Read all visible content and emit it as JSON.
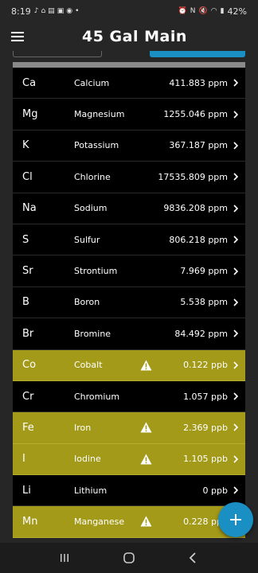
{
  "status_bar": {
    "time": "8:19",
    "battery": "42%",
    "icons_left": [
      "tiktok-icon",
      "home-icon",
      "news-icon",
      "gallery-icon",
      "app-icon",
      "dot-icon"
    ],
    "icons_right": [
      "alarm-icon",
      "nfc-icon",
      "mute-icon",
      "wifi-icon",
      "signal-icon"
    ]
  },
  "app_bar": {
    "title": "45 Gal Main",
    "menu_icon": "hamburger-menu-icon"
  },
  "colors": {
    "background": "#262626",
    "row": "#000000",
    "warning_row": "#a39a1a",
    "accent": "#1a8fc4"
  },
  "elements": [
    {
      "symbol": "Ca",
      "name": "Calcium",
      "value": "411.883 ppm",
      "warning": false
    },
    {
      "symbol": "Mg",
      "name": "Magnesium",
      "value": "1255.046 ppm",
      "warning": false
    },
    {
      "symbol": "K",
      "name": "Potassium",
      "value": "367.187 ppm",
      "warning": false
    },
    {
      "symbol": "Cl",
      "name": "Chlorine",
      "value": "17535.809 ppm",
      "warning": false
    },
    {
      "symbol": "Na",
      "name": "Sodium",
      "value": "9836.208 ppm",
      "warning": false
    },
    {
      "symbol": "S",
      "name": "Sulfur",
      "value": "806.218 ppm",
      "warning": false
    },
    {
      "symbol": "Sr",
      "name": "Strontium",
      "value": "7.969 ppm",
      "warning": false
    },
    {
      "symbol": "B",
      "name": "Boron",
      "value": "5.538 ppm",
      "warning": false
    },
    {
      "symbol": "Br",
      "name": "Bromine",
      "value": "84.492 ppm",
      "warning": false
    },
    {
      "symbol": "Co",
      "name": "Cobalt",
      "value": "0.122 ppb",
      "warning": true
    },
    {
      "symbol": "Cr",
      "name": "Chromium",
      "value": "1.057 ppb",
      "warning": false
    },
    {
      "symbol": "Fe",
      "name": "Iron",
      "value": "2.369 ppb",
      "warning": true
    },
    {
      "symbol": "I",
      "name": "Iodine",
      "value": "1.105 ppb",
      "warning": true
    },
    {
      "symbol": "Li",
      "name": "Lithium",
      "value": "0 ppb",
      "warning": false
    },
    {
      "symbol": "Mn",
      "name": "Manganese",
      "value": "0.228 ppb",
      "warning": true
    }
  ],
  "fab": {
    "icon": "plus-icon"
  },
  "nav_bar": {
    "icons": [
      "recent-apps-icon",
      "home-button-icon",
      "back-icon"
    ]
  }
}
